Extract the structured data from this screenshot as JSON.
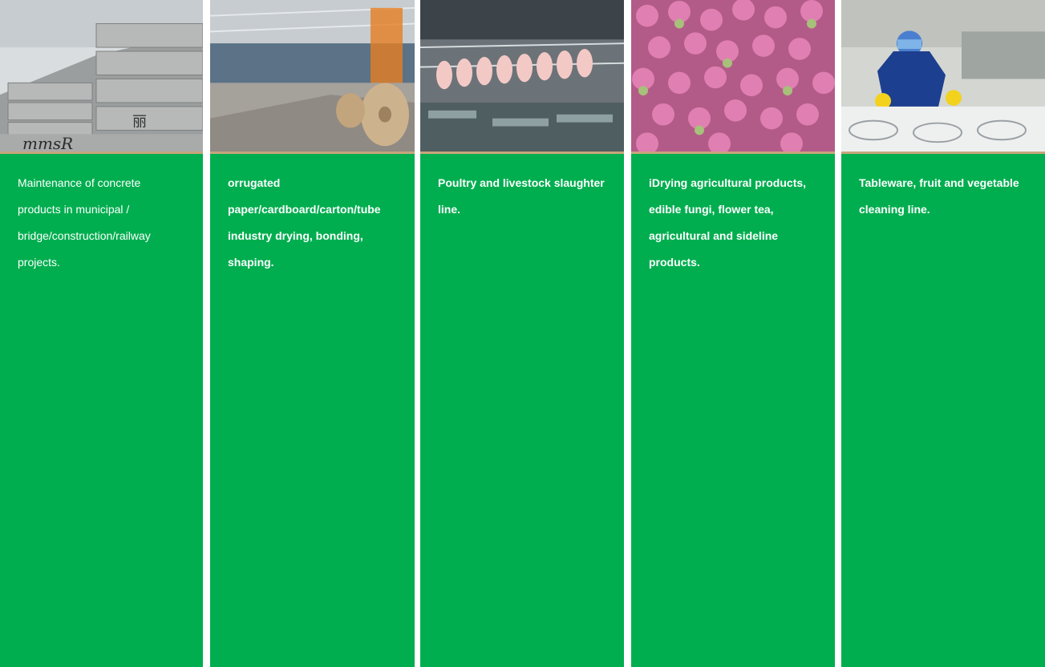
{
  "colors": {
    "panel_green": "#00ae4f",
    "photo_border": "#c9a57b"
  },
  "columns": [
    {
      "id": "concrete",
      "image": "concrete-blocks-photo",
      "watermark": "mmsR",
      "sign": "丽",
      "text": "Maintenance of concrete products in municipal / bridge/construction/railway projects."
    },
    {
      "id": "cardboard",
      "image": "paper-mill-photo",
      "text": "orrugated paper/cardboard/carton/tube industry drying, bonding, shaping."
    },
    {
      "id": "poultry",
      "image": "slaughter-line-photo",
      "text": "Poultry and livestock slaughter line."
    },
    {
      "id": "agri",
      "image": "rose-buds-photo",
      "text": "iDrying agricultural products, edible fungi, flower tea, agricultural and sideline products."
    },
    {
      "id": "tableware",
      "image": "cleaning-line-photo",
      "text": "Tableware, fruit and vegetable cleaning line."
    }
  ]
}
